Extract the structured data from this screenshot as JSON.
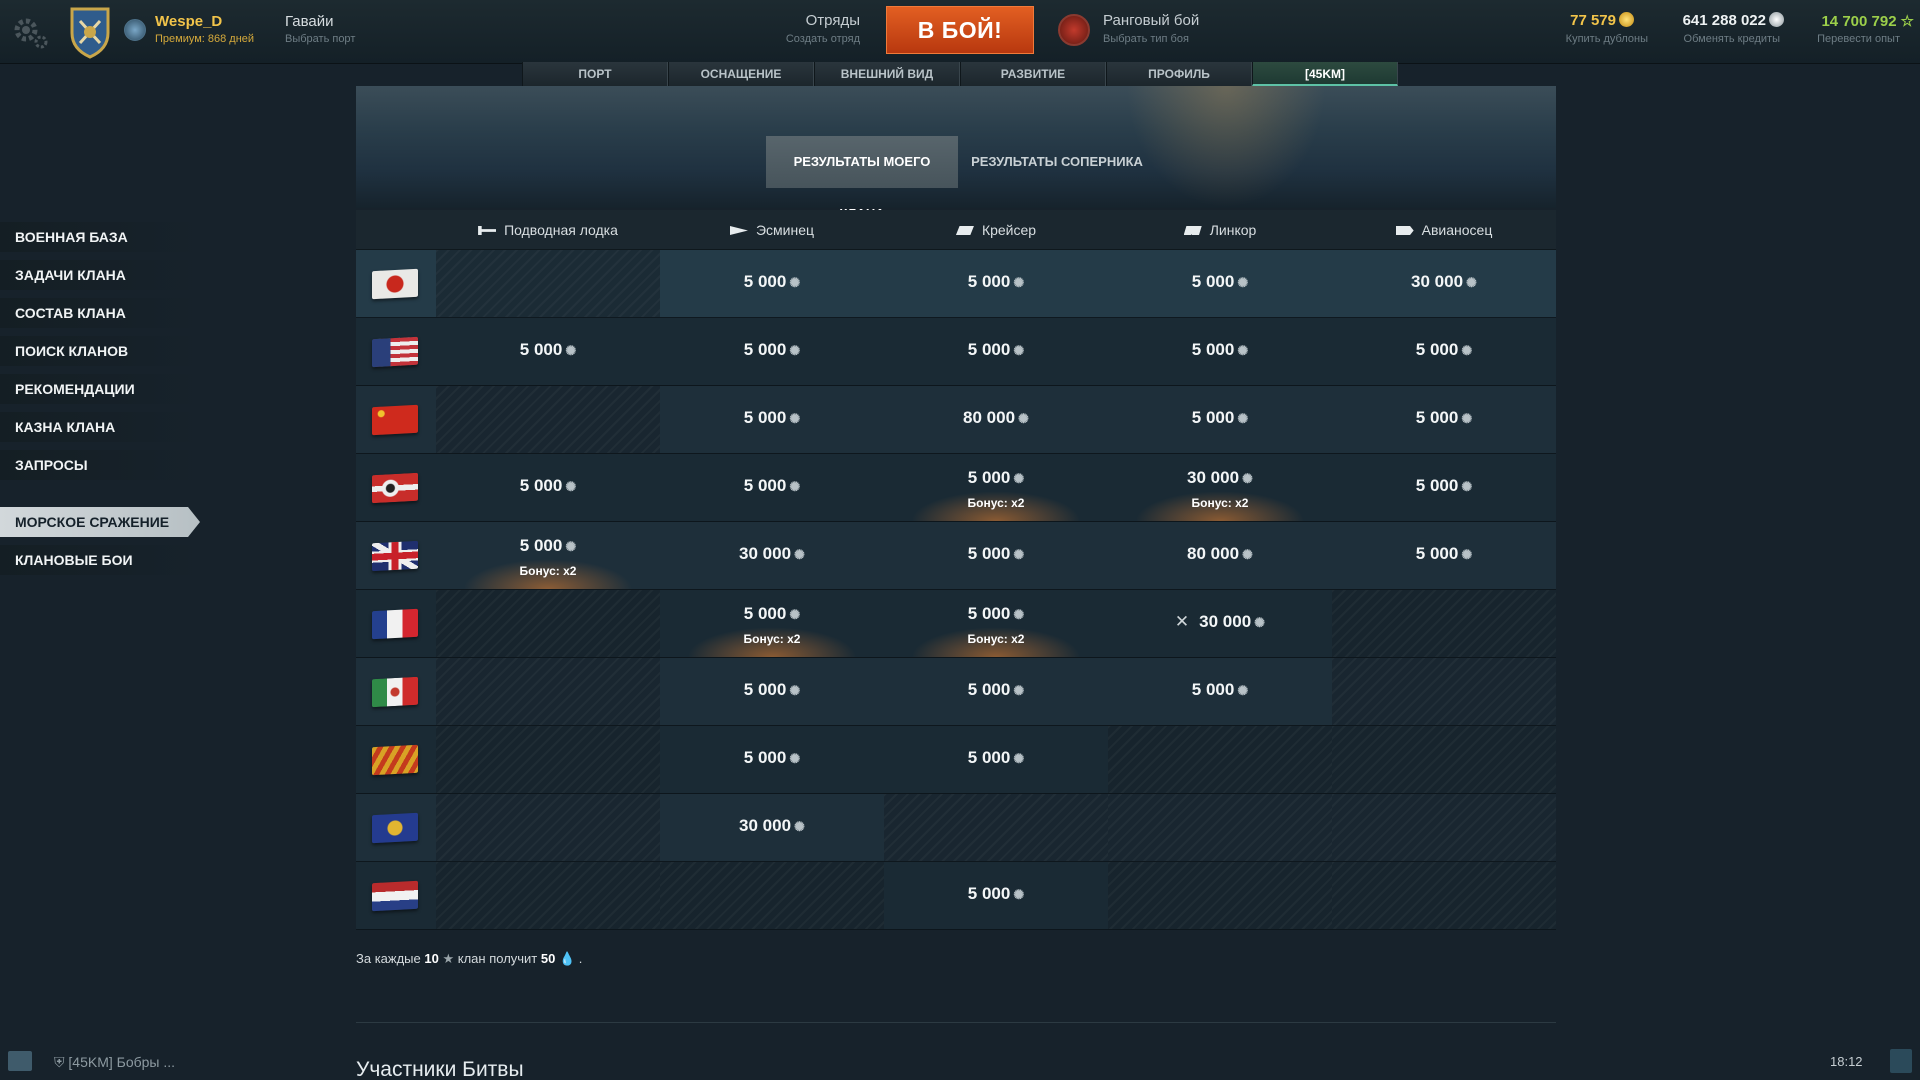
{
  "topbar": {
    "player_name": "Wespe_D",
    "premium": "Премиум: 868 дней",
    "port_name": "Гавайи",
    "port_sub": "Выбрать порт",
    "squad_label": "Отряды",
    "squad_sub": "Создать отряд",
    "battle_button": "В БОЙ!",
    "mode_label": "Ранговый бой",
    "mode_sub": "Выбрать тип боя",
    "doubloons": "77 579",
    "doubloons_sub": "Купить дублоны",
    "credits": "641 288 022",
    "credits_sub": "Обменять кредиты",
    "xp": "14 700 792",
    "xp_sub": "Перевести опыт"
  },
  "tabs": [
    {
      "label": "ПОРТ"
    },
    {
      "label": "ОСНАЩЕНИЕ"
    },
    {
      "label": "ВНЕШНИЙ ВИД"
    },
    {
      "label": "РАЗВИТИЕ"
    },
    {
      "label": "ПРОФИЛЬ"
    },
    {
      "label": "[45KM]"
    }
  ],
  "leftnav": [
    {
      "label": "ВОЕННАЯ БАЗА"
    },
    {
      "label": "ЗАДАЧИ КЛАНА"
    },
    {
      "label": "СОСТАВ КЛАНА"
    },
    {
      "label": "ПОИСК КЛАНОВ"
    },
    {
      "label": "РЕКОМЕНДАЦИИ"
    },
    {
      "label": "КАЗНА КЛАНА"
    },
    {
      "label": "ЗАПРОСЫ"
    },
    {
      "label": "МОРСКОЕ СРАЖЕНИЕ"
    },
    {
      "label": "КЛАНОВЫЕ БОИ"
    }
  ],
  "subtabs": {
    "my_clan": "РЕЗУЛЬТАТЫ МОЕГО КЛАНА",
    "rival": "РЕЗУЛЬТАТЫ СОПЕРНИКА"
  },
  "columns": [
    "Подводная лодка",
    "Эсминец",
    "Крейсер",
    "Линкор",
    "Авианосец"
  ],
  "leaf_glyph": "✺",
  "rows": {
    "japan": {
      "c0": "",
      "c1": "5 000",
      "c2": "5 000",
      "c3": "5 000",
      "c4": "30 000"
    },
    "usa": {
      "c0": "5 000",
      "c1": "5 000",
      "c2": "5 000",
      "c3": "5 000",
      "c4": "5 000"
    },
    "ussr": {
      "c0": "",
      "c1": "5 000",
      "c2": "80 000",
      "c3": "5 000",
      "c4": "5 000"
    },
    "germany": {
      "c0": "5 000",
      "c1": "5 000",
      "c2": "5 000",
      "c3": "30 000",
      "c4": "5 000"
    },
    "uk": {
      "c0": "5 000",
      "c1": "30 000",
      "c2": "5 000",
      "c3": "80 000",
      "c4": "5 000"
    },
    "france": {
      "c0": "",
      "c1": "5 000",
      "c2": "5 000",
      "c3": "30 000",
      "c4": ""
    },
    "italy": {
      "c0": "",
      "c1": "5 000",
      "c2": "5 000",
      "c3": "5 000",
      "c4": ""
    },
    "spain": {
      "c0": "",
      "c1": "5 000",
      "c2": "5 000",
      "c3": "",
      "c4": ""
    },
    "europe": {
      "c0": "",
      "c1": "30 000",
      "c2": "",
      "c3": "",
      "c4": ""
    },
    "netherlands": {
      "c0": "",
      "c1": "",
      "c2": "5 000",
      "c3": "",
      "c4": ""
    }
  },
  "bonus_label": "Бонус: x2",
  "note": {
    "prefix": "За каждые",
    "stars": "10",
    "mid": "клан получит",
    "oil": "50",
    "suffix": "."
  },
  "section_title": "Участники Битвы",
  "footer": {
    "clan_chat": "[45KM] Бобры ...",
    "time": "18:12"
  },
  "colors": {
    "accent": "#e0581f",
    "gold": "#f2c44a",
    "xp_green": "#9ccf4a"
  }
}
